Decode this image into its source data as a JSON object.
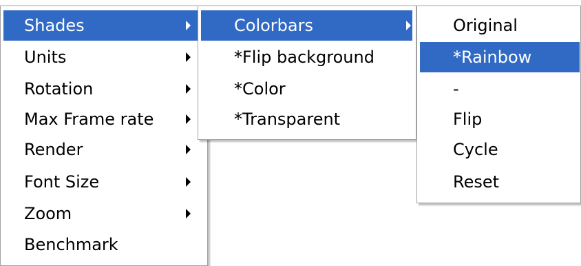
{
  "menu_level1": {
    "items": [
      {
        "label": "Shades"
      },
      {
        "label": "Units"
      },
      {
        "label": "Rotation"
      },
      {
        "label": "Max Frame rate"
      },
      {
        "label": "Render"
      },
      {
        "label": "Font Size"
      },
      {
        "label": "Zoom"
      },
      {
        "label": "Benchmark"
      }
    ],
    "selected": "Shades"
  },
  "menu_level2": {
    "items": [
      {
        "label": "Colorbars"
      },
      {
        "label": "*Flip background"
      },
      {
        "label": "*Color"
      },
      {
        "label": "*Transparent"
      }
    ],
    "selected": "Colorbars"
  },
  "menu_level3": {
    "items": [
      {
        "label": "Original"
      },
      {
        "label": "*Rainbow"
      },
      {
        "label": "-"
      },
      {
        "label": "Flip"
      },
      {
        "label": "Cycle"
      },
      {
        "label": "Reset"
      }
    ],
    "selected": "*Rainbow"
  },
  "colors": {
    "highlight": "#316ac5",
    "highlight_text": "#ffffff",
    "menu_background": "#ffffff",
    "menu_border": "#a0a0a0"
  },
  "icons": {
    "submenu_arrow": "chevron-right-icon"
  }
}
